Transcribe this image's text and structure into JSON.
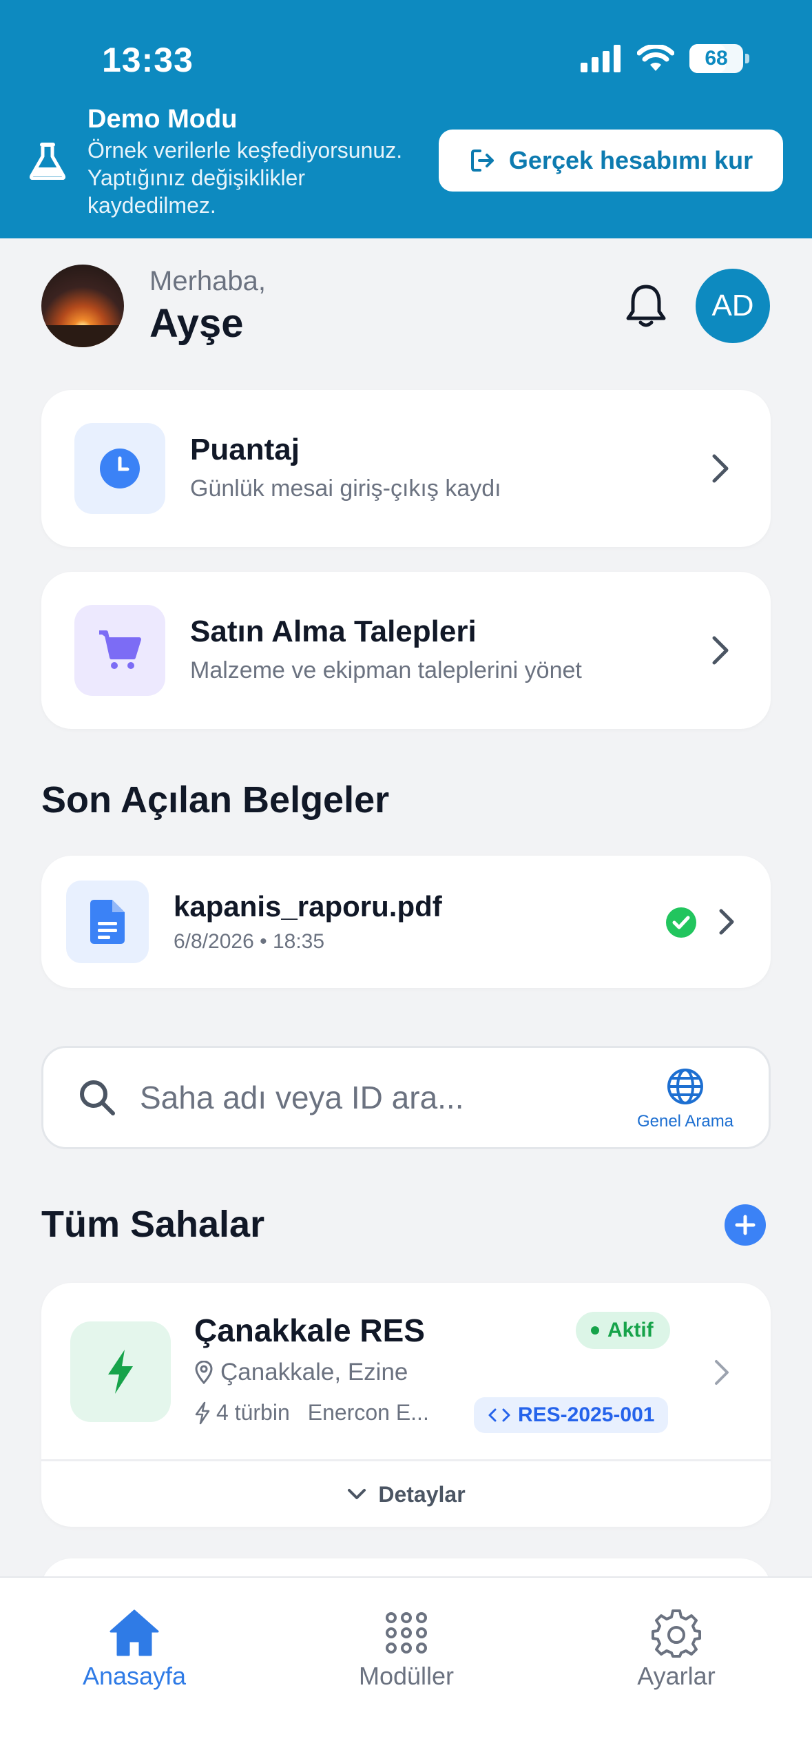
{
  "status_bar": {
    "time": "13:33",
    "battery": "68"
  },
  "demo_banner": {
    "title": "Demo Modu",
    "text": "Örnek verilerle keşfediyorsunuz. Yaptığınız değişiklikler kaydedilmez.",
    "button_label": "Gerçek hesabımı kur"
  },
  "header": {
    "greeting": "Merhaba,",
    "name": "Ayşe",
    "initials": "AD"
  },
  "menu_cards": [
    {
      "title": "Puantaj",
      "subtitle": "Günlük mesai giriş-çıkış kaydı"
    },
    {
      "title": "Satın Alma Talepleri",
      "subtitle": "Malzeme ve ekipman taleplerini yönet"
    }
  ],
  "recent_docs": {
    "section_title": "Son Açılan Belgeler",
    "items": [
      {
        "name": "kapanis_raporu.pdf",
        "date": "6/8/2026 • 18:35"
      }
    ]
  },
  "search": {
    "placeholder": "Saha adı veya ID ara...",
    "global_label": "Genel Arama"
  },
  "sites": {
    "section_title": "Tüm Sahalar",
    "items": [
      {
        "name": "Çanakkale RES",
        "status": "Aktif",
        "location": "Çanakkale, Ezine",
        "turbines": "4 türbin",
        "model": "Enercon E...",
        "id": "RES-2025-001",
        "details_label": "Detaylar"
      }
    ]
  },
  "bottom_nav": [
    {
      "label": "Anasayfa",
      "icon": "home-icon",
      "active": true
    },
    {
      "label": "Modüller",
      "icon": "grid-icon",
      "active": false
    },
    {
      "label": "Ayarlar",
      "icon": "gear-icon",
      "active": false
    }
  ],
  "colors": {
    "banner": "#0d8ac0",
    "accent": "#3b82f6",
    "success": "#16a34a",
    "background": "#f2f3f5"
  }
}
